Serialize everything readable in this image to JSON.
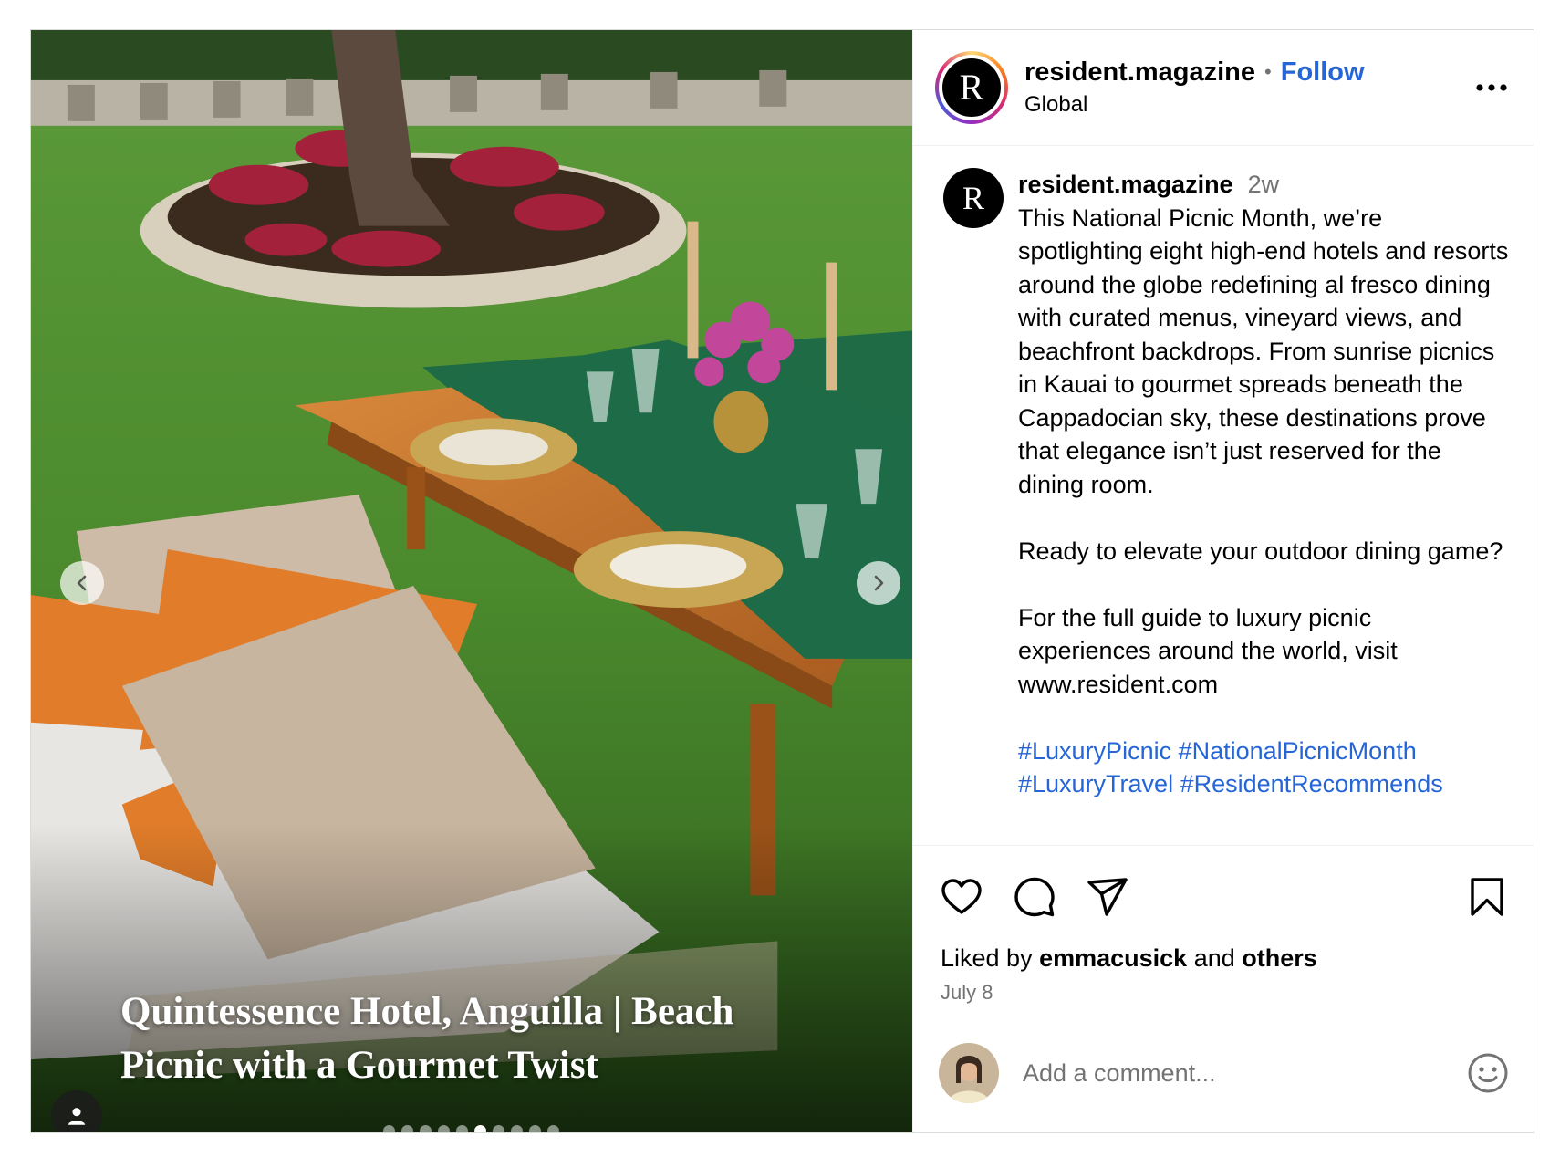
{
  "post": {
    "author": {
      "username": "resident.magazine",
      "logo_letter": "R",
      "location": "Global",
      "follow_label": "Follow",
      "separator": "•"
    },
    "media": {
      "overlay_text": "Quintessence Hotel, Anguilla | Beach Picnic with a Gourmet Twist",
      "slide_count": 10,
      "active_slide_index": 5
    },
    "caption": {
      "username": "resident.magazine",
      "time_ago": "2w",
      "paragraph1": "This National Picnic Month, we’re spotlighting eight high-end hotels and resorts around the globe redefining al fresco dining with curated menus, vineyard views, and beachfront backdrops. From sunrise picnics in Kauai to gourmet spreads beneath the Cappadocian sky, these destinations prove that elegance isn’t just reserved for the dining room.",
      "paragraph2": "Ready to elevate your outdoor dining game?",
      "paragraph3": "For the full guide to luxury picnic experiences around the world, visit www.resident.com",
      "hashtags": "#LuxuryPicnic #NationalPicnicMonth #LuxuryTravel #ResidentRecommends"
    },
    "actions": {
      "icons": [
        "heart-icon",
        "comment-icon",
        "share-icon",
        "bookmark-icon"
      ]
    },
    "likes": {
      "prefix": "Liked by",
      "user": "emmacusick",
      "conjunction": "and",
      "others": "others"
    },
    "date": "July 8",
    "comment": {
      "placeholder": "Add a comment..."
    }
  },
  "colors": {
    "link_blue": "#2565d6",
    "muted_text": "#737373",
    "border": "#dbdbdb"
  }
}
